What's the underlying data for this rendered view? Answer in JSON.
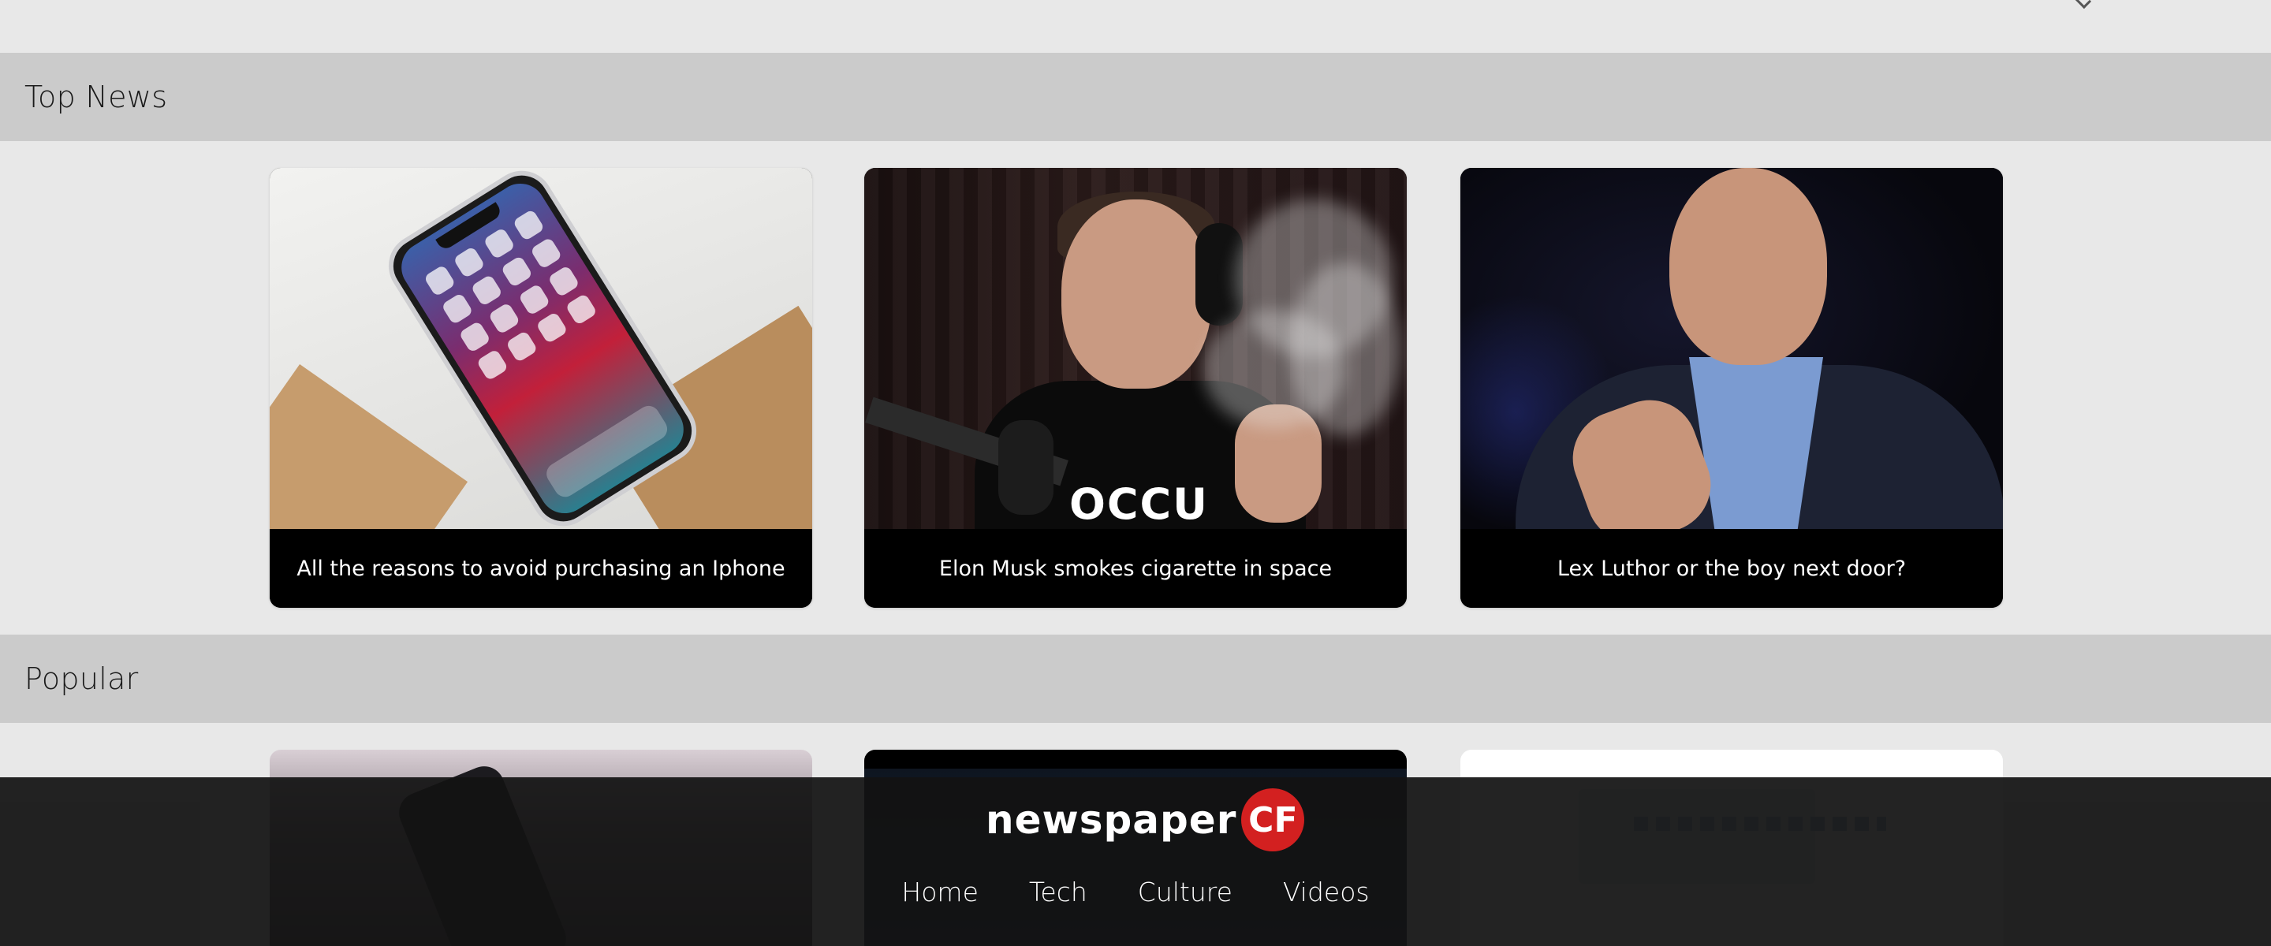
{
  "sections": {
    "top_news": {
      "title": "Top News"
    },
    "popular": {
      "title": "Popular"
    }
  },
  "top_news_cards": [
    {
      "caption": "All the reasons to avoid purchasing an Iphone",
      "image": "iphone-photo"
    },
    {
      "caption": "Elon Musk smokes cigarette in space",
      "image": "elon-musk-photo"
    },
    {
      "caption": "Lex Luthor or the boy next door?",
      "image": "jeff-bezos-photo"
    }
  ],
  "elon_shirt_text": "OCCU",
  "footer": {
    "logo_word": "newspaper",
    "logo_badge": "CF",
    "nav": [
      "Home",
      "Tech",
      "Culture",
      "Videos"
    ]
  },
  "colors": {
    "page_bg": "#e8e8e8",
    "section_bar_bg": "#cbcbcb",
    "caption_bg": "#000000",
    "footer_bg": "#121212",
    "logo_badge": "#d32020"
  }
}
